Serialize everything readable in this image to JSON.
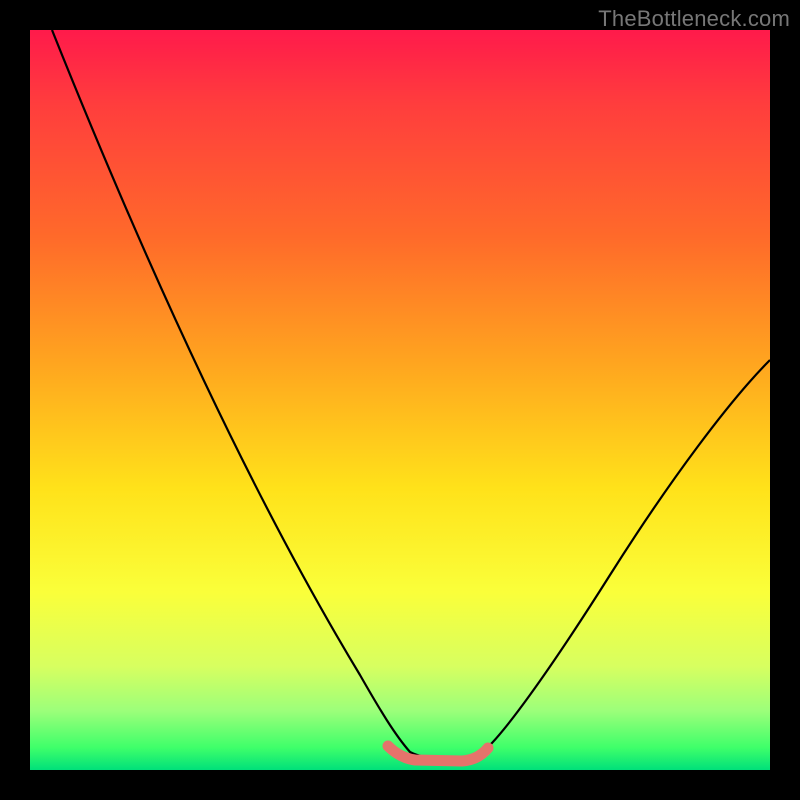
{
  "watermark": "TheBottleneck.com",
  "chart_data": {
    "type": "line",
    "title": "",
    "xlabel": "",
    "ylabel": "",
    "xlim": [
      0,
      100
    ],
    "ylim": [
      0,
      100
    ],
    "x": [
      3,
      10,
      20,
      30,
      40,
      46,
      50,
      53,
      56,
      60,
      70,
      80,
      90,
      100
    ],
    "values": [
      100,
      86,
      67,
      47,
      27,
      13,
      4,
      1,
      0.5,
      1,
      12,
      28,
      42,
      55
    ],
    "annotations": [
      "min-plateau"
    ],
    "min_plateau": {
      "x_start": 48,
      "x_end": 60,
      "y": 0.7
    }
  }
}
